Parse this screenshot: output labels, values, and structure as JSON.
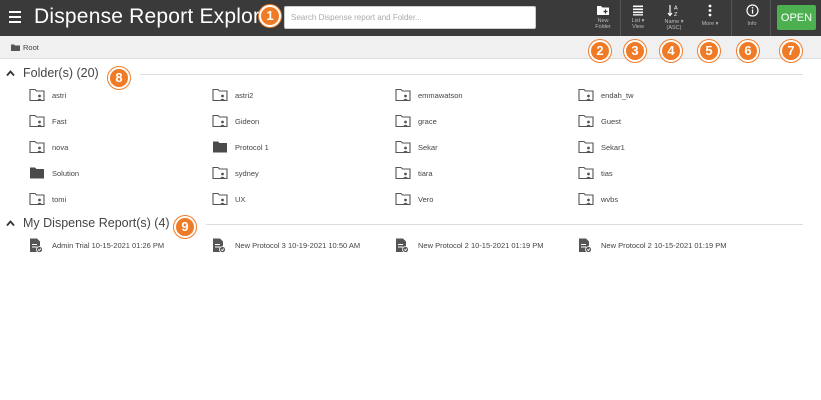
{
  "header": {
    "title": "Dispense Report Explorer",
    "search_placeholder": "Search Dispense report and Folder..."
  },
  "toolbar": {
    "new_folder": {
      "line1": "New",
      "line2": "Folder",
      "icon": "folder-plus-icon"
    },
    "list_view": {
      "line1": "List",
      "line2": "View",
      "icon": "list-view-icon"
    },
    "sort": {
      "line1": "Name",
      "line2": "(ASC)",
      "icon": "sort-az-icon"
    },
    "more": {
      "line1": "More",
      "icon": "more-vertical-icon"
    },
    "info": {
      "line1": "Info",
      "icon": "info-icon"
    },
    "open_label": "OPEN"
  },
  "breadcrumb": {
    "root": "Root"
  },
  "folders": {
    "title": "Folder(s) (20)",
    "items": [
      {
        "name": "astri",
        "type": "shared"
      },
      {
        "name": "astri2",
        "type": "shared"
      },
      {
        "name": "emmawatson",
        "type": "shared"
      },
      {
        "name": "endah_tw",
        "type": "shared"
      },
      {
        "name": "Fast",
        "type": "shared"
      },
      {
        "name": "Gideon",
        "type": "shared"
      },
      {
        "name": "grace",
        "type": "shared"
      },
      {
        "name": "Guest",
        "type": "shared"
      },
      {
        "name": "nova",
        "type": "shared"
      },
      {
        "name": "Protocol 1",
        "type": "solid"
      },
      {
        "name": "Sekar",
        "type": "shared"
      },
      {
        "name": "Sekar1",
        "type": "shared"
      },
      {
        "name": "Solution",
        "type": "solid"
      },
      {
        "name": "sydney",
        "type": "shared"
      },
      {
        "name": "tiara",
        "type": "shared"
      },
      {
        "name": "tias",
        "type": "shared"
      },
      {
        "name": "tomi",
        "type": "shared"
      },
      {
        "name": "UX",
        "type": "shared"
      },
      {
        "name": "Vero",
        "type": "shared"
      },
      {
        "name": "wvbs",
        "type": "shared"
      }
    ]
  },
  "reports": {
    "title": "My Dispense Report(s) (4)",
    "items": [
      {
        "name": "Admin Trial 10-15-2021 01:26 PM"
      },
      {
        "name": "New Protocol 3 10-19-2021 10:50 AM"
      },
      {
        "name": "New Protocol 2 10-15-2021 01:19 PM"
      },
      {
        "name": "New Protocol 2 10-15-2021 01:19 PM"
      }
    ]
  },
  "callouts": [
    "1",
    "2",
    "3",
    "4",
    "5",
    "6",
    "7",
    "8",
    "9"
  ],
  "colors": {
    "header_bg": "#3a3a3a",
    "open_button": "#4caf50",
    "callout": "#f07b27"
  }
}
